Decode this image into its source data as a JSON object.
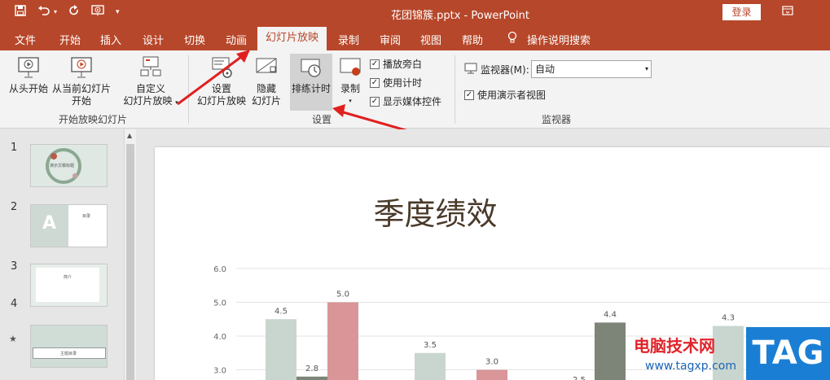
{
  "window": {
    "doc_title": "花团锦簇.pptx  -  PowerPoint",
    "login_label": "登录",
    "qat_icons": [
      "save-icon",
      "undo-icon",
      "redo-icon",
      "slideshow-start-icon",
      "customize-icon"
    ]
  },
  "tabs": [
    "文件",
    "开始",
    "插入",
    "设计",
    "切换",
    "动画",
    "幻灯片放映",
    "录制",
    "审阅",
    "视图",
    "帮助",
    "操作说明搜索"
  ],
  "active_tab": "幻灯片放映",
  "ribbon": {
    "from_start": "从头开始",
    "from_current_1": "从当前幻灯片",
    "from_current_2": "开始",
    "custom_1": "自定义",
    "custom_2": "幻灯片放映",
    "group_start": "开始放映幻灯片",
    "setup_1": "设置",
    "setup_2": "幻灯片放映",
    "hide_1": "隐藏",
    "hide_2": "幻灯片",
    "rehearse": "排练计时",
    "record": "录制",
    "chk_narration": "播放旁白",
    "chk_timings": "使用计时",
    "chk_media": "显示媒体控件",
    "group_setup": "设置",
    "monitor_label": "监视器(M):",
    "monitor_value": "自动",
    "chk_presenter": "使用演示者视图",
    "group_monitor": "监视器"
  },
  "thumbnails": [
    {
      "num": "1",
      "title": "演示文稿标题"
    },
    {
      "num": "2",
      "title": "目录"
    },
    {
      "num": "3",
      "title": "简介"
    },
    {
      "num": "4",
      "title": "主题目录",
      "star": "★"
    }
  ],
  "slide": {
    "title": "季度绩效"
  },
  "chart_data": {
    "type": "bar",
    "ylim": [
      2.5,
      6.0
    ],
    "yticks": [
      "6.0",
      "5.0",
      "4.0",
      "3.0"
    ],
    "series": [
      {
        "name": "",
        "color": "#c9d6cf",
        "values": [
          4.5,
          3.5,
          null,
          4.3
        ]
      },
      {
        "name": "",
        "color": "#7d8478",
        "values": [
          2.8,
          null,
          4.4,
          null
        ]
      },
      {
        "name": "",
        "color": "#d99597",
        "values": [
          5.0,
          3.0,
          null,
          null
        ]
      }
    ],
    "data_labels": [
      "4.5",
      "2.8",
      "5.0",
      "3.5",
      "3.0",
      "2.5",
      "4.4",
      "4.3"
    ]
  },
  "watermark": {
    "text": "电脑技术网",
    "url": "www.tagxp.com",
    "tag": "TAG"
  }
}
